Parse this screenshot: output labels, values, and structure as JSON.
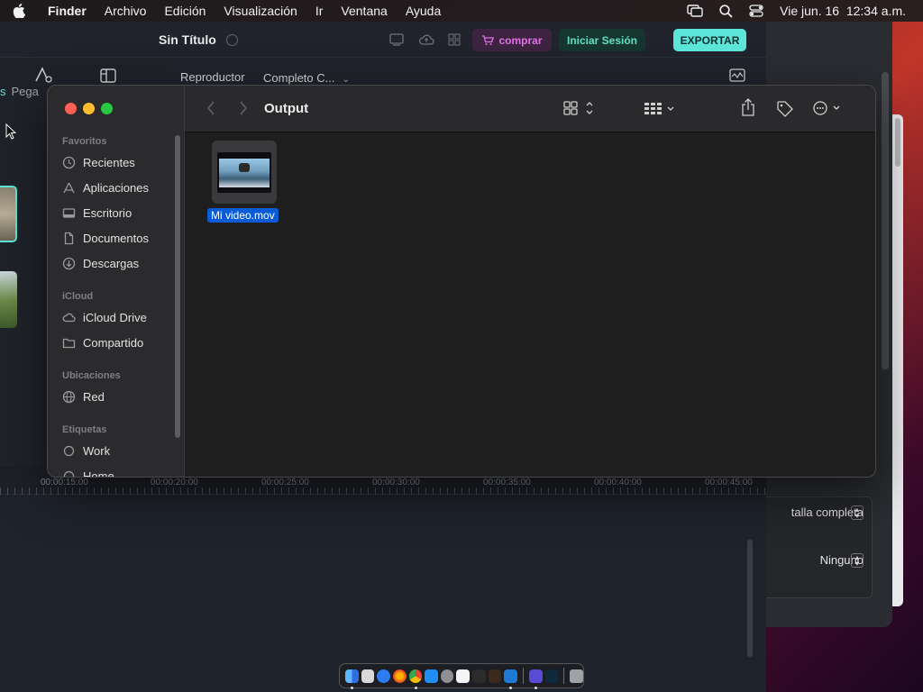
{
  "menubar": {
    "app_name": "Finder",
    "menus": [
      "Archivo",
      "Edición",
      "Visualización",
      "Ir",
      "Ventana",
      "Ayuda"
    ],
    "datetime": "Vie jun. 16  12:34 a.m."
  },
  "editor": {
    "title": "Sin Título",
    "buy_label": "comprar",
    "login_label": "Iniciar Sesión",
    "export_label": "EXPORTAR",
    "left_tab_partial_prefix": "s",
    "left_tab_partial": "Pega",
    "player_label": "Reproductor",
    "player_mode": "Completo C...",
    "timecodes": [
      "00:00:15:00",
      "00:00:20:00",
      "00:00:25:00",
      "00:00:30:00",
      "00:00:35:00",
      "00:00:40:00",
      "00:00:45:00"
    ]
  },
  "inspector": {
    "display_mode": "talla completa",
    "option_value": "Ninguno"
  },
  "finder": {
    "path_title": "Output",
    "sidebar": {
      "favorites_header": "Favoritos",
      "favorites": [
        "Recientes",
        "Aplicaciones",
        "Escritorio",
        "Documentos",
        "Descargas"
      ],
      "icloud_header": "iCloud",
      "icloud": [
        "iCloud Drive",
        "Compartido"
      ],
      "locations_header": "Ubicaciones",
      "locations": [
        "Red"
      ],
      "tags_header": "Etiquetas",
      "tags": [
        "Work",
        "Home"
      ]
    },
    "files": [
      {
        "name": "Mi video.mov",
        "selected": true
      }
    ]
  },
  "colors": {
    "accent_teal": "#5ce5d9",
    "selection_blue": "#0a5bd6",
    "buy_pink": "#e46fe9"
  }
}
